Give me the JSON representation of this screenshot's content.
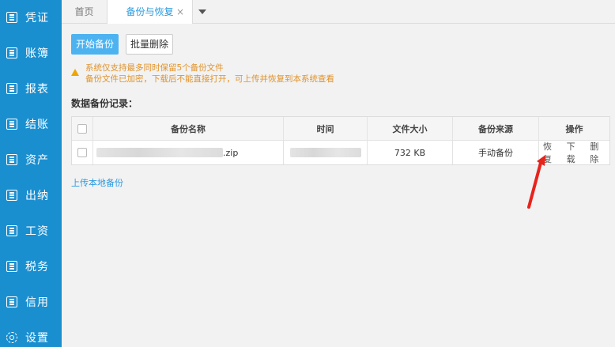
{
  "sidebar": {
    "items": [
      {
        "label": "凭证",
        "icon": "voucher-icon"
      },
      {
        "label": "账簿",
        "icon": "ledger-icon"
      },
      {
        "label": "报表",
        "icon": "report-icon"
      },
      {
        "label": "结账",
        "icon": "checkout-icon"
      },
      {
        "label": "资产",
        "icon": "asset-icon"
      },
      {
        "label": "出纳",
        "icon": "cashier-icon"
      },
      {
        "label": "工资",
        "icon": "salary-icon"
      },
      {
        "label": "税务",
        "icon": "tax-icon"
      },
      {
        "label": "信用",
        "icon": "credit-icon"
      },
      {
        "label": "设置",
        "icon": "gear-icon"
      }
    ]
  },
  "tabs": {
    "home": "首页",
    "active": "备份与恢复",
    "close": "×"
  },
  "toolbar": {
    "start_backup": "开始备份",
    "batch_delete": "批量删除"
  },
  "warning": {
    "line1": "系统仅支持最多同时保留5个备份文件",
    "line2": "备份文件已加密，下载后不能直接打开，可上传并恢复到本系统查看"
  },
  "section_title": "数据备份记录：",
  "table": {
    "headers": {
      "name": "备份名称",
      "time": "时间",
      "size": "文件大小",
      "source": "备份来源",
      "ops": "操作"
    },
    "rows": [
      {
        "name_suffix": ".zip",
        "size": "732 KB",
        "source": "手动备份",
        "ops": {
          "restore": "恢复",
          "download": "下载",
          "delete": "删除"
        }
      }
    ]
  },
  "upload_link": "上传本地备份",
  "colors": {
    "sidebar": "#1a8fd0",
    "accent": "#2a9ae0",
    "warning": "#e0932b",
    "annotation_arrow": "#e8231c"
  }
}
